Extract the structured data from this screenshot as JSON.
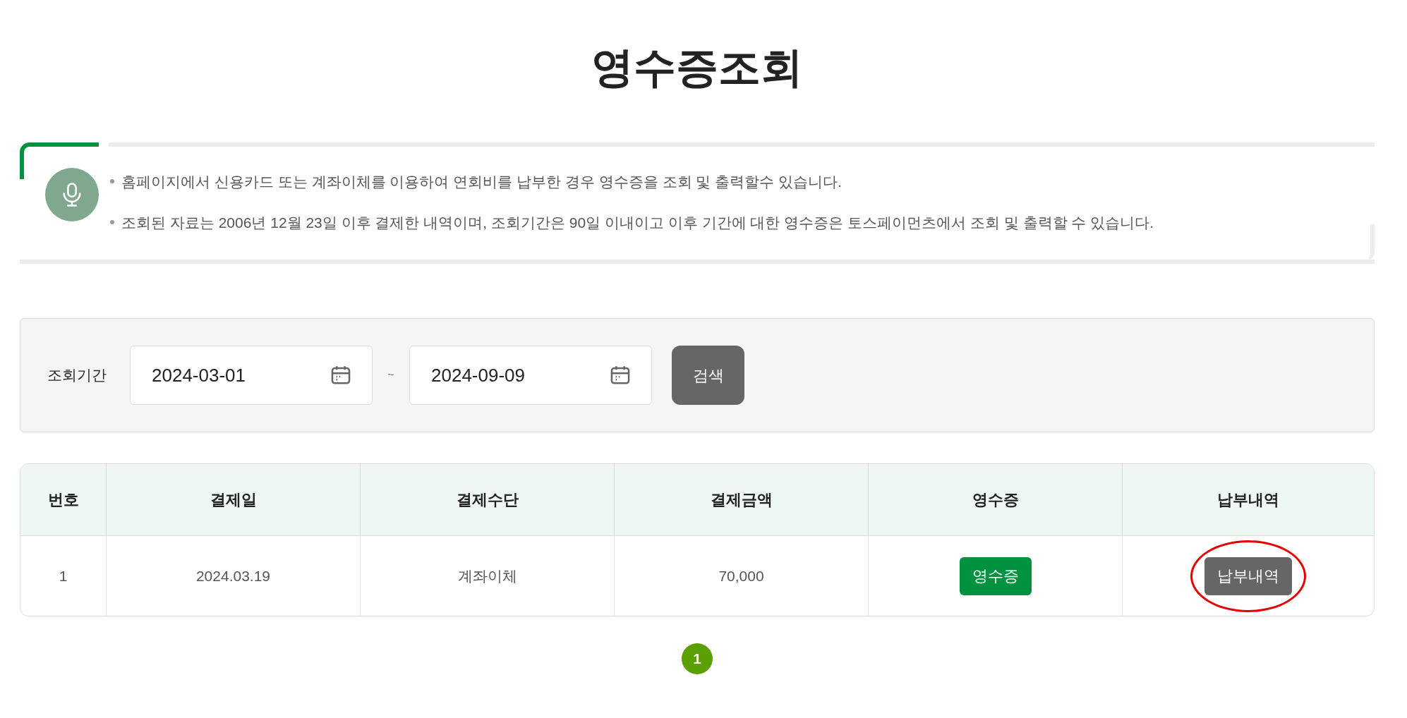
{
  "title": "영수증조회",
  "notice": {
    "items": [
      "홈페이지에서 신용카드 또는 계좌이체를 이용하여 연회비를 납부한 경우 영수증을 조회 및 출력할수 있습니다.",
      "조회된 자료는 2006년 12월 23일 이후 결제한 내역이며, 조회기간은 90일 이내이고 이후 기간에 대한 영수증은 토스페이먼츠에서 조회 및 출력할 수 있습니다."
    ]
  },
  "search": {
    "label": "조회기간",
    "start_date": "2024-03-01",
    "separator": "~",
    "end_date": "2024-09-09",
    "button": "검색"
  },
  "table": {
    "columns": [
      "번호",
      "결제일",
      "결제수단",
      "결제금액",
      "영수증",
      "납부내역"
    ],
    "rows": [
      {
        "number": "1",
        "date": "2024.03.19",
        "method": "계좌이체",
        "amount": "70,000",
        "receipt_button": "영수증",
        "history_button": "납부내역",
        "history_circled": true
      }
    ]
  },
  "pagination": [
    {
      "label": "1",
      "selected": true
    }
  ]
}
